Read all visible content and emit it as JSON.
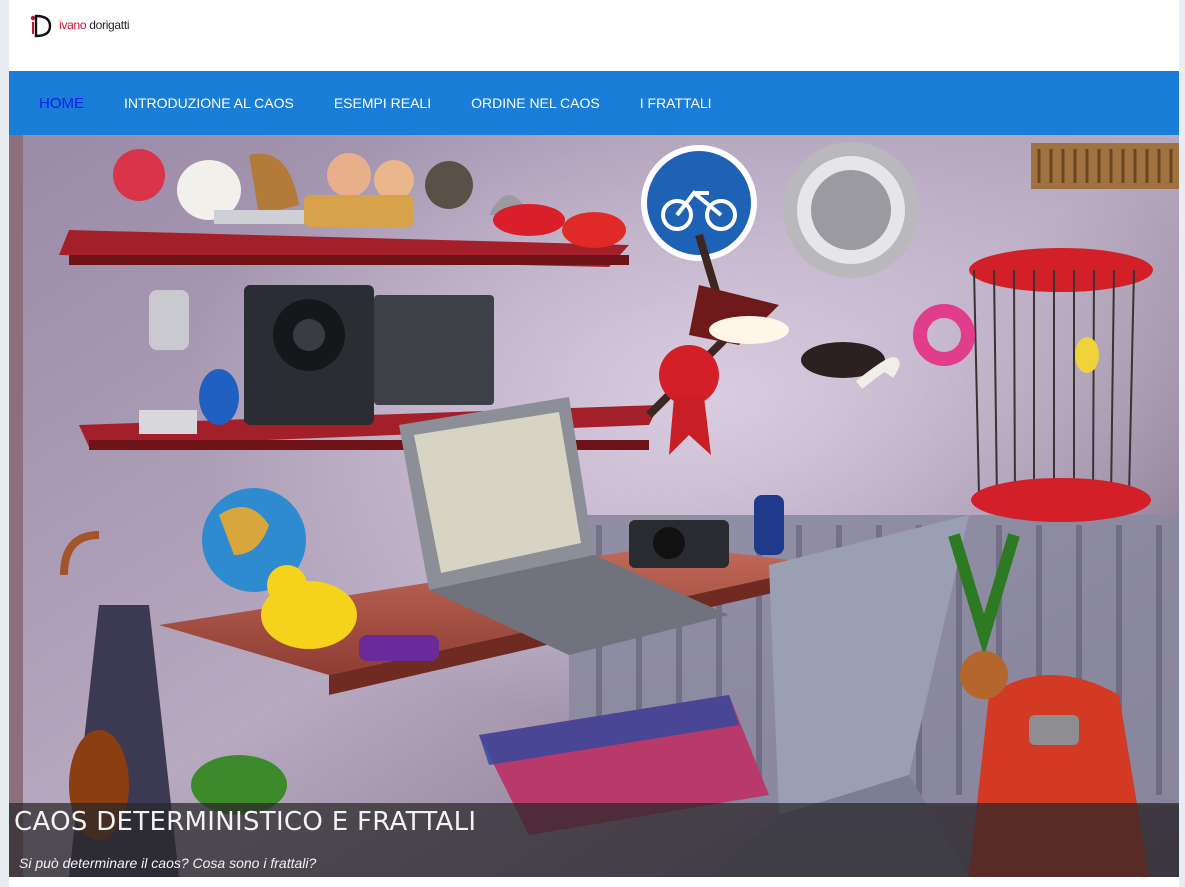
{
  "brand": {
    "logo_icon": "ivano-dorigatti-logo-icon",
    "first_name": "ivano",
    "last_name": "dorigatti"
  },
  "nav": {
    "items": [
      {
        "label": "HOME",
        "active": true
      },
      {
        "label": "INTRODUZIONE AL CAOS",
        "active": false
      },
      {
        "label": "ESEMPI REALI",
        "active": false
      },
      {
        "label": "ORDINE NEL CAOS",
        "active": false
      },
      {
        "label": "I FRATTALI",
        "active": false
      }
    ]
  },
  "hero": {
    "image_icon": "cluttered-room-illustration",
    "caption_title": "CAOS DETERMINISTICO E FRATTALI",
    "caption_subtitle": "Si può determinare il caos? Cosa sono i frattali?"
  },
  "colors": {
    "nav_background": "#1a7ed8",
    "nav_text": "#ffffff",
    "nav_active": "#0a1ee8",
    "brand_red": "#c8102e"
  }
}
